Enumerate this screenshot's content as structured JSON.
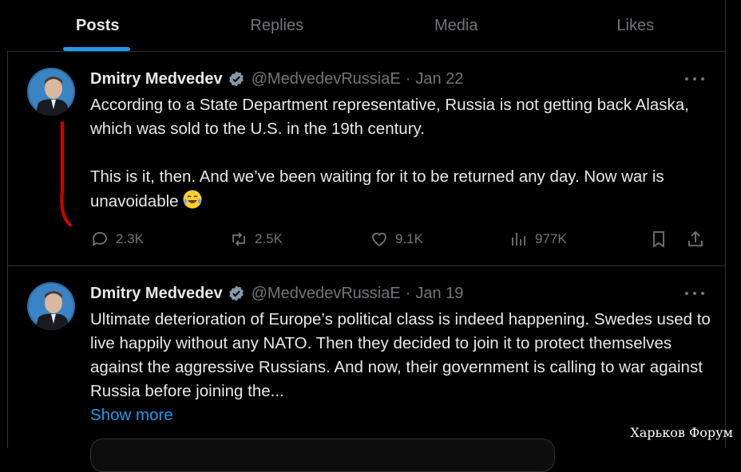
{
  "tabs": [
    {
      "label": "Posts",
      "active": true
    },
    {
      "label": "Replies",
      "active": false
    },
    {
      "label": "Media",
      "active": false
    },
    {
      "label": "Likes",
      "active": false
    }
  ],
  "tweets": [
    {
      "name": "Dmitry Medvedev",
      "handle": "@MedvedevRussiaE",
      "date": "Jan 22",
      "text1": "According to a State Department representative, Russia is not getting back Alaska, which was sold to the U.S. in the 19th century.",
      "text2": "This is it, then. And we’ve been waiting for it to be returned any day. Now war is unavoidable",
      "emoji": "face-with-tears-of-joy-emoji",
      "replies": "2.3K",
      "reposts": "2.5K",
      "likes": "9.1K",
      "views": "977K"
    },
    {
      "name": "Dmitry Medvedev",
      "handle": "@MedvedevRussiaE",
      "date": "Jan 19",
      "text1": "Ultimate deterioration of Europe’s political class is indeed happening. Swedes used to live happily without any NATO. Then they decided to join it to protect themselves against the aggressive Russians. And now, their government is calling to war against Russia before joining the...",
      "show_more": "Show more"
    }
  ],
  "watermark": "Харьков Форум",
  "colors": {
    "accent": "#1d9bf0",
    "muted": "#71767b",
    "text": "#e7e9ea",
    "annotation": "#d40000"
  }
}
